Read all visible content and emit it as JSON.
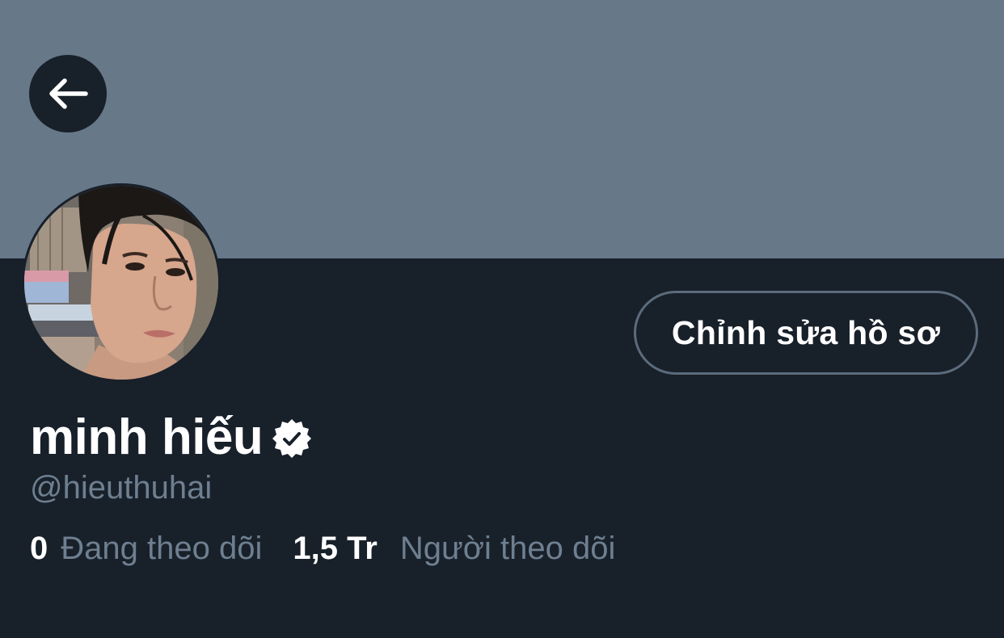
{
  "colors": {
    "banner": "#677889",
    "background": "#18202a",
    "text_primary": "#ffffff",
    "text_secondary": "#6e7f90",
    "button_border": "#5b6b7b"
  },
  "header": {
    "back_icon": "arrow-left-icon"
  },
  "profile": {
    "edit_button_label": "Chỉnh sửa hồ sơ",
    "display_name": "minh hiếu",
    "verified_icon": "verified-badge-icon",
    "handle": "@hieuthuhai",
    "following": {
      "count": "0",
      "label": "Đang theo dõi"
    },
    "followers": {
      "count": "1,5 Tr",
      "label": "Người theo dõi"
    }
  }
}
